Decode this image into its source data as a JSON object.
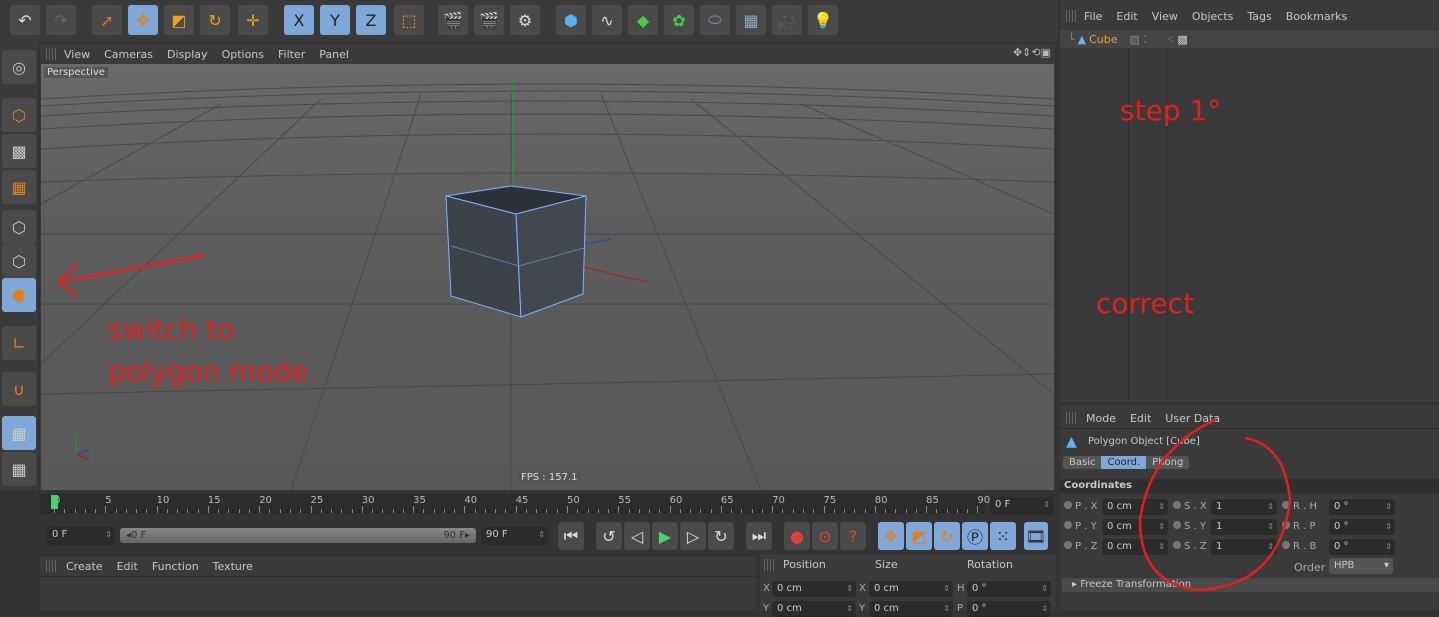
{
  "top_toolbar": {
    "icons": [
      "undo-icon",
      "redo-icon",
      "live-selection-icon",
      "move-icon",
      "scale-icon",
      "rotate-icon",
      "recent-tool-icon",
      "x-axis-icon",
      "y-axis-icon",
      "z-axis-icon",
      "coordinate-system-icon",
      "render-view-icon",
      "render-picture-viewer-icon",
      "render-settings-icon",
      "cube-icon",
      "spline-icon",
      "nurbs-icon",
      "array-icon",
      "deformer-icon",
      "floor-icon",
      "camera-icon",
      "light-icon"
    ],
    "x": "X",
    "y": "Y",
    "z": "Z"
  },
  "object_manager": {
    "menu": [
      "File",
      "Edit",
      "View",
      "Objects",
      "Tags",
      "Bookmarks"
    ],
    "objects": [
      {
        "name": "Cube"
      }
    ]
  },
  "viewport": {
    "menu": [
      "View",
      "Cameras",
      "Display",
      "Options",
      "Filter",
      "Panel"
    ],
    "label": "Perspective",
    "fps": "FPS : 157.1"
  },
  "left_toolbar": {
    "icons": [
      "make-editable-icon",
      "model-mode-icon",
      "texture-mode-icon",
      "workplane-icon",
      "points-mode-icon",
      "edges-mode-icon",
      "polygons-mode-icon",
      "axis-mode-icon",
      "snap-icon",
      "locked-workplane-icon",
      "planar-workplane-icon"
    ],
    "active": "polygons-mode-icon"
  },
  "annotations": {
    "step": "step 1°",
    "correct": "correct",
    "instruction_line1": "switch to",
    "instruction_line2": "polygon mode",
    "color": "#e02020"
  },
  "attributes": {
    "menu": [
      "Mode",
      "Edit",
      "User Data"
    ],
    "title": "Polygon Object [Cube]",
    "tabs": [
      "Basic",
      "Coord.",
      "Phong"
    ],
    "active_tab": "Coord.",
    "section": "Coordinates",
    "rows": [
      {
        "p_label": "P . X",
        "p": "0 cm",
        "s_label": "S . X",
        "s": "1",
        "r_label": "R . H",
        "r": "0 °"
      },
      {
        "p_label": "P . Y",
        "p": "0 cm",
        "s_label": "S . Y",
        "s": "1",
        "r_label": "R . P",
        "r": "0 °"
      },
      {
        "p_label": "P . Z",
        "p": "0 cm",
        "s_label": "S . Z",
        "s": "1",
        "r_label": "R . B",
        "r": "0 °"
      }
    ],
    "order_label": "Order",
    "order": "HPB",
    "freeze": "Freeze Transformation"
  },
  "timeline": {
    "ticks": [
      "0",
      "5",
      "10",
      "15",
      "20",
      "25",
      "30",
      "35",
      "40",
      "45",
      "50",
      "55",
      "60",
      "65",
      "70",
      "75",
      "80",
      "85",
      "90"
    ],
    "current": "0 F",
    "start": "0 F",
    "range_start": "0 F",
    "range_end": "90 F",
    "end": "90 F"
  },
  "material_manager": {
    "menu": [
      "Create",
      "Edit",
      "Function",
      "Texture"
    ]
  },
  "coord_manager": {
    "headers": [
      "Position",
      "Size",
      "Rotation"
    ],
    "rows": [
      {
        "a": "X",
        "pos": "0 cm",
        "b": "X",
        "size": "0 cm",
        "c": "H",
        "rot": "0 °"
      },
      {
        "a": "Y",
        "pos": "0 cm",
        "b": "Y",
        "size": "0 cm",
        "c": "P",
        "rot": "0 °"
      }
    ]
  }
}
